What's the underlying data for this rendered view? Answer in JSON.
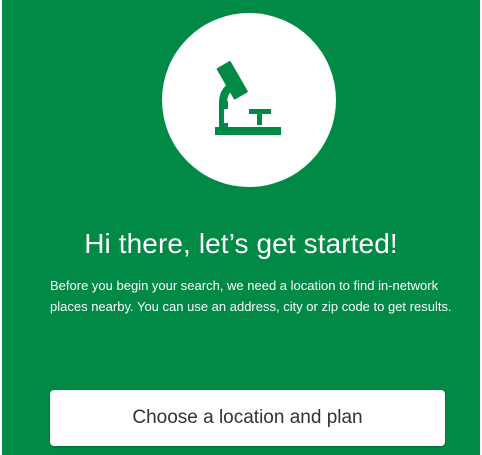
{
  "colors": {
    "panel_background": "#008a45",
    "circle_background": "#ffffff",
    "icon_color": "#008a45",
    "text_on_panel": "#ffffff",
    "button_background": "#ffffff",
    "button_text": "#333333"
  },
  "hero": {
    "icon": "microscope-icon"
  },
  "intro": {
    "heading": "Hi there, let’s get started!",
    "description": "Before you begin your search, we need a location to find in-network places nearby. You can use an address, city or zip code to get results."
  },
  "actions": {
    "choose_location_label": "Choose a location and plan"
  }
}
